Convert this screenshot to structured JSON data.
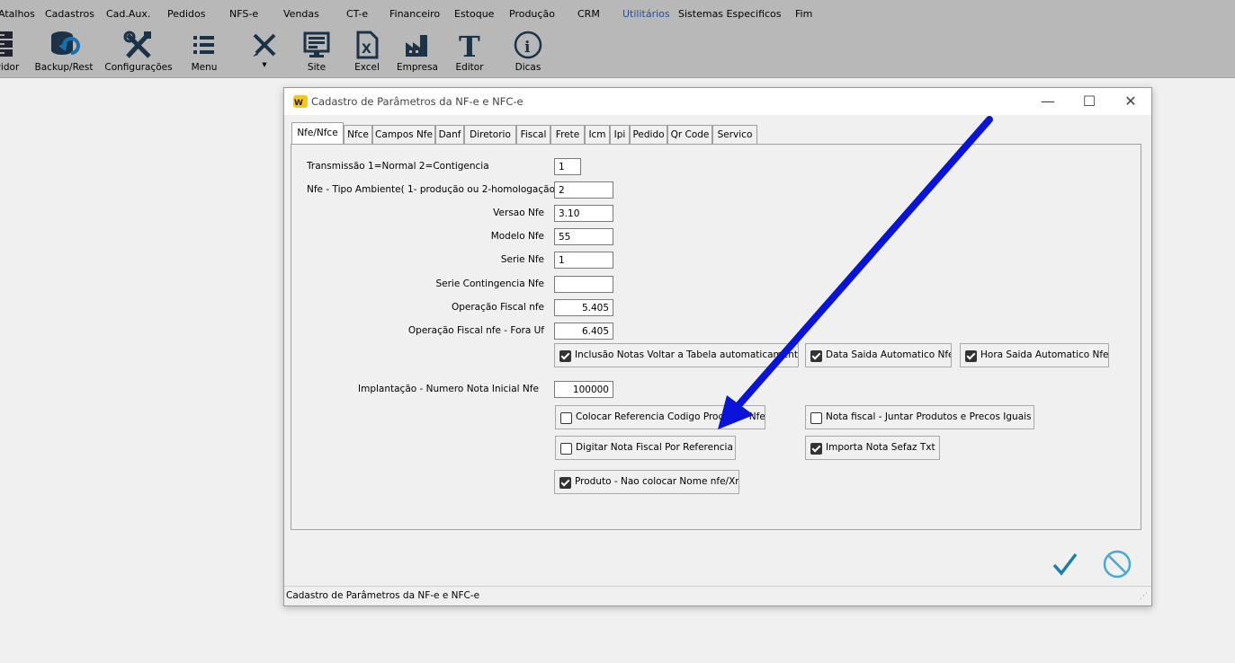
{
  "menubar": {
    "items": [
      "Atalhos",
      "Cadastros",
      "Cad.Aux.",
      "Pedidos",
      "NFS-e",
      "Vendas",
      "CT-e",
      "Financeiro",
      "Estoque",
      "Produção",
      "CRM",
      "Utilitários",
      "Sistemas Especificos",
      "Fim"
    ],
    "active_item": "Utilitários"
  },
  "toolbar": {
    "buttons": [
      {
        "label": "vidor",
        "icon": "server-icon"
      },
      {
        "label": "Backup/Rest",
        "icon": "backup-icon"
      },
      {
        "label": "Configurações",
        "icon": "tools-icon"
      },
      {
        "label": "Menu",
        "icon": "menu-icon"
      },
      {
        "label": "",
        "icon": "pencil-ruler-icon"
      },
      {
        "label": "Site",
        "icon": "monitor-icon"
      },
      {
        "label": "Excel",
        "icon": "excel-icon"
      },
      {
        "label": "Empresa",
        "icon": "factory-icon"
      },
      {
        "label": "Editor",
        "icon": "text-editor-icon"
      },
      {
        "label": "Dicas",
        "icon": "info-icon"
      }
    ]
  },
  "dialog": {
    "title": "Cadastro de Parâmetros da NF-e e NFC-e",
    "tabs": [
      "Nfe/Nfce",
      "Nfce",
      "Campos Nfe",
      "Danf",
      "Diretorio",
      "Fiscal",
      "Frete",
      "Icm",
      "Ipi",
      "Pedido",
      "Qr Code",
      "Servico"
    ],
    "selected_tab": "Nfe/Nfce",
    "fields": {
      "transmissao": {
        "label": "Transmissão 1=Normal 2=Contigencia",
        "value": "1"
      },
      "tipo_ambiente": {
        "label": "Nfe - Tipo Ambiente( 1- produção ou 2-homologação)",
        "value": "2"
      },
      "versao": {
        "label": "Versao Nfe",
        "value": "3.10"
      },
      "modelo": {
        "label": "Modelo Nfe",
        "value": "55"
      },
      "serie": {
        "label": "Serie Nfe",
        "value": "1"
      },
      "serie_contingencia": {
        "label": "Serie Contingencia Nfe",
        "value": ""
      },
      "operacao_fiscal": {
        "label": "Operação Fiscal nfe",
        "value": "5.405"
      },
      "operacao_fiscal_fora": {
        "label": "Operação Fiscal nfe - Fora Uf",
        "value": "6.405"
      },
      "implantacao": {
        "label": "Implantação - Numero Nota Inicial Nfe",
        "value": "100000"
      }
    },
    "checkboxes": {
      "inclusao_notas": {
        "label": "Inclusão Notas Voltar a Tabela automaticamente",
        "checked": true
      },
      "data_saida": {
        "label": "Data Saida Automatico Nfe",
        "checked": true
      },
      "hora_saida": {
        "label": "Hora Saida Automatico Nfe",
        "checked": true
      },
      "colocar_referencia": {
        "label": "Colocar Referencia Codigo Produto - Nfe",
        "checked": false
      },
      "juntar_produtos": {
        "label": "Nota fiscal - Juntar Produtos e Precos Iguais",
        "checked": false
      },
      "digitar_nota": {
        "label": "Digitar Nota Fiscal Por Referencia",
        "checked": false
      },
      "importa_nota": {
        "label": "Importa Nota Sefaz Txt",
        "checked": true
      },
      "produto_nome": {
        "label": "Produto - Nao colocar Nome nfe/Xml",
        "checked": true
      }
    },
    "status_text": "Cadastro de Parâmetros da NF-e e NFC-e"
  },
  "colors": {
    "toolbar_bg": "#b8b8b8",
    "accent": "#1c7fa8",
    "arrow": "#0a14d6"
  }
}
